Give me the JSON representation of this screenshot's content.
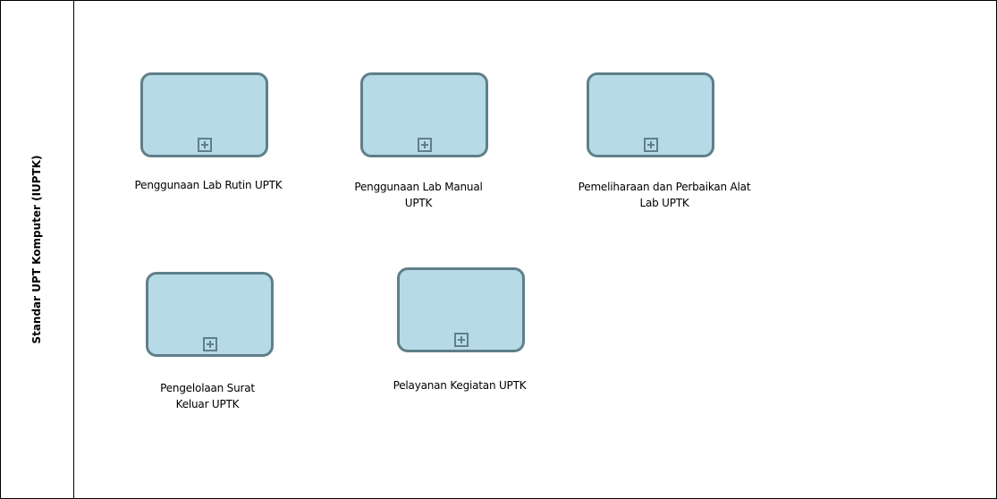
{
  "diagram": {
    "lane": {
      "title": "Standar UPT Komputer (IUPTK)"
    },
    "tasks": [
      {
        "label": "Penggunaan Lab  Rutin UPTK"
      },
      {
        "label": "Penggunaan Lab   Manual\nUPTK"
      },
      {
        "label": "Pemeliharaan dan Perbaikan Alat\nLab UPTK"
      },
      {
        "label": "Pengelolaan Surat\nKeluar UPTK"
      },
      {
        "label": "Pelayanan Kegiatan UPTK"
      }
    ],
    "colors": {
      "task_fill": "#b7dbe6",
      "task_border": "#5f7f8a",
      "lines": "#000000"
    },
    "icons": {
      "task_marker": "subprocess-plus-icon"
    }
  }
}
